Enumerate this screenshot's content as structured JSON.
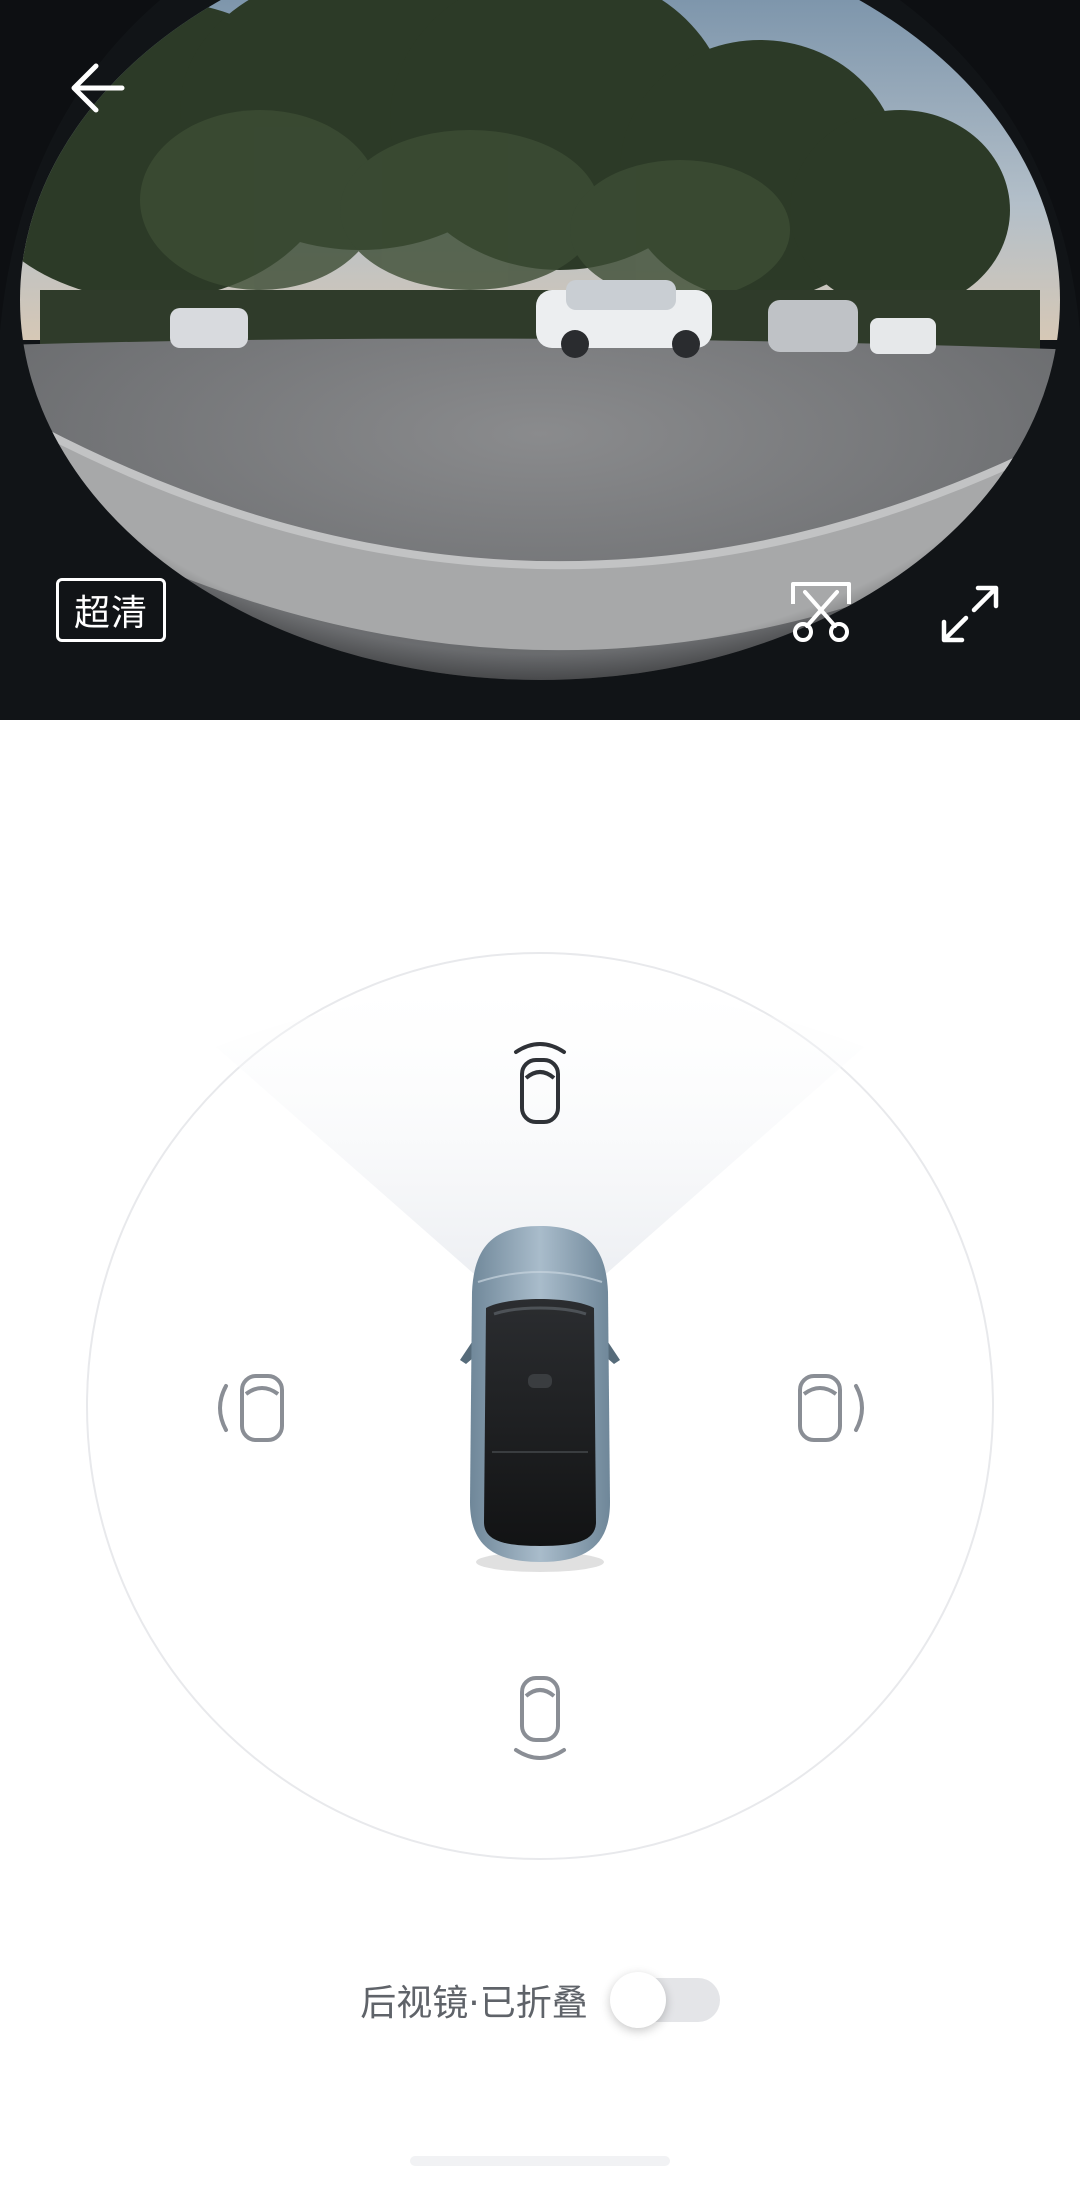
{
  "camera": {
    "quality_label": "超清",
    "icons": {
      "back": "arrow-left-icon",
      "snapshot": "scissors-icon",
      "fullscreen": "expand-icon"
    }
  },
  "views": {
    "front": "car-front-camera-icon",
    "left": "car-left-camera-icon",
    "right": "car-right-camera-icon",
    "rear": "car-rear-camera-icon"
  },
  "mirror": {
    "label": "后视镜·已折叠",
    "toggle_on": false
  },
  "colors": {
    "accent_car": "#8fa6b8",
    "toggle_off": "#e4e5e8",
    "label": "#5f6369",
    "icon": "#3a3d42"
  }
}
